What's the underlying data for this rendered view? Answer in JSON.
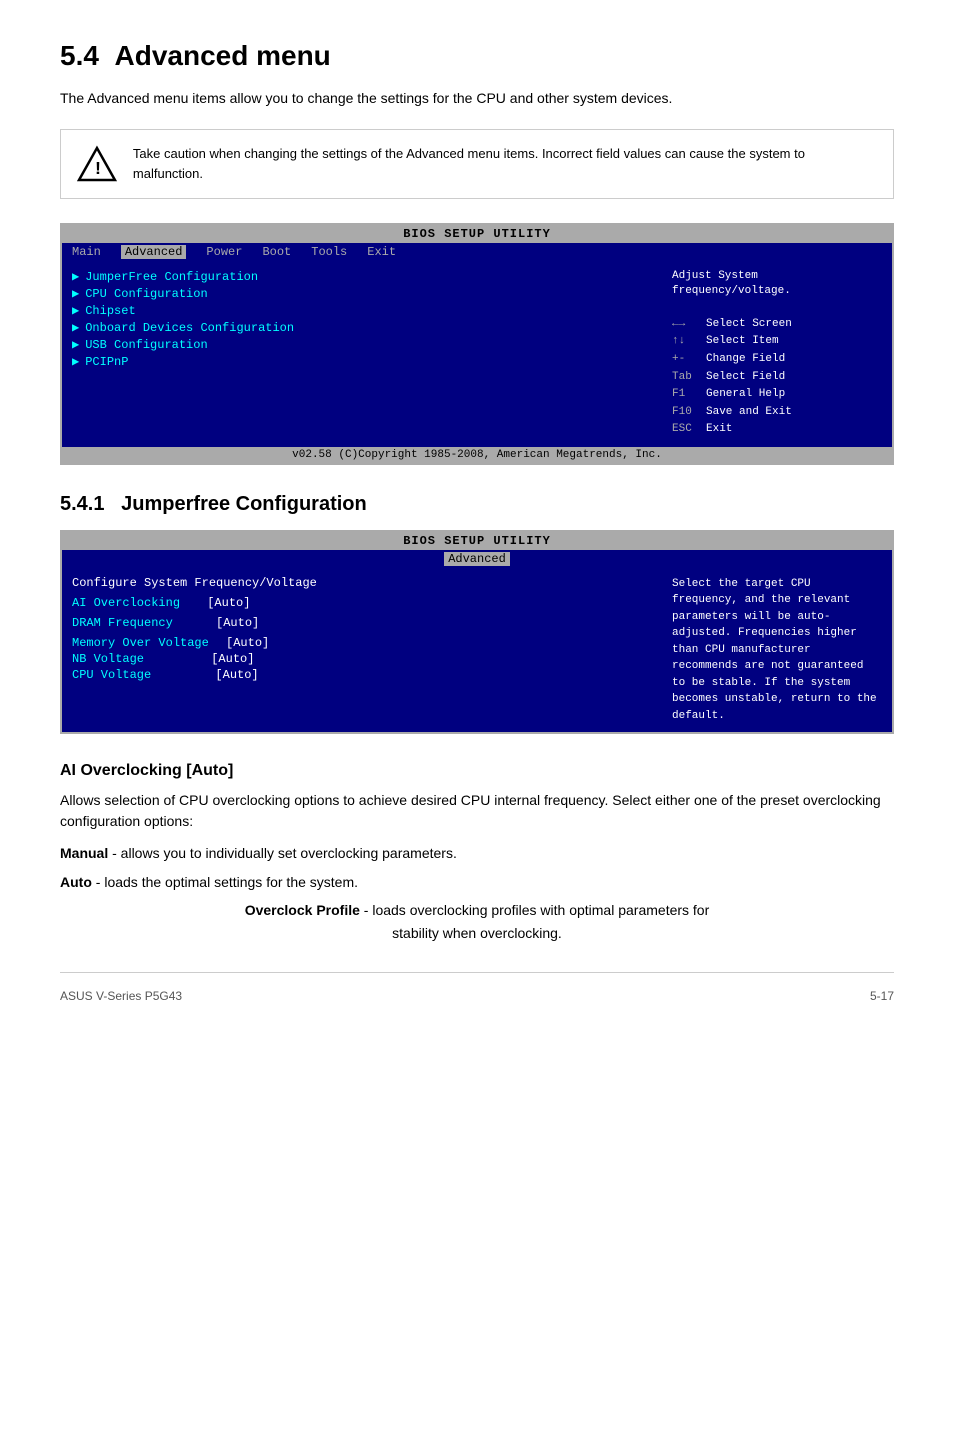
{
  "page": {
    "section_number": "5.4",
    "section_title": "Advanced menu",
    "intro": "The Advanced menu items allow you to change the settings for the CPU and other system devices.",
    "caution": {
      "text": "Take caution when changing the settings of the Advanced menu items. Incorrect field values can cause the system to malfunction."
    },
    "bios1": {
      "title": "BIOS SETUP UTILITY",
      "menu_items": [
        "Main",
        "Advanced",
        "Power",
        "Boot",
        "Tools",
        "Exit"
      ],
      "active_menu": "Advanced",
      "left_items": [
        "JumperFree Configuration",
        "CPU Configuration",
        "Chipset",
        "Onboard Devices Configuration",
        "USB Configuration",
        "PCIPnP"
      ],
      "right_help": "Adjust System frequency/voltage.",
      "keys": [
        {
          "key": "←→",
          "action": "Select Screen"
        },
        {
          "key": "↑↓",
          "action": "Select Item"
        },
        {
          "key": "+-",
          "action": "Change Field"
        },
        {
          "key": "Tab",
          "action": "Select Field"
        },
        {
          "key": "F1",
          "action": "General Help"
        },
        {
          "key": "F10",
          "action": "Save and Exit"
        },
        {
          "key": "ESC",
          "action": "Exit"
        }
      ],
      "bottom_bar": "v02.58 (C)Copyright 1985-2008, American Megatrends, Inc."
    },
    "subsection": {
      "number": "5.4.1",
      "title": "Jumperfree Configuration",
      "bios2": {
        "title": "BIOS SETUP UTILITY",
        "active_menu": "Advanced",
        "section_label": "Configure System Frequency/Voltage",
        "items": [
          {
            "label": "AI Overclocking",
            "value": "[Auto]",
            "highlighted": true
          },
          {
            "label": "DRAM Frequency",
            "value": "[Auto]"
          },
          {
            "label": "Memory Over Voltage",
            "value": "[Auto]"
          },
          {
            "label": "NB Voltage",
            "value": "[Auto]"
          },
          {
            "label": "CPU Voltage",
            "value": "[Auto]"
          }
        ],
        "right_help": "Select the target CPU frequency, and the relevant parameters will be auto-adjusted. Frequencies higher than CPU manufacturer recommends are not guaranteed to be stable. If the system becomes unstable, return to the default."
      }
    },
    "ai_overclocking": {
      "heading": "AI Overclocking [Auto]",
      "intro": "Allows selection of CPU overclocking options to achieve desired CPU internal frequency. Select either one of the preset overclocking configuration options:",
      "options": [
        {
          "name": "Manual",
          "desc": "- allows you to individually set overclocking parameters."
        },
        {
          "name": "Auto",
          "desc": "- loads the optimal settings for the system."
        },
        {
          "name": "Overclock Profile",
          "desc": "- loads overclocking profiles with optimal parameters for stability when overclocking."
        }
      ]
    },
    "footer": {
      "left": "ASUS V-Series P5G43",
      "right": "5-17"
    }
  }
}
